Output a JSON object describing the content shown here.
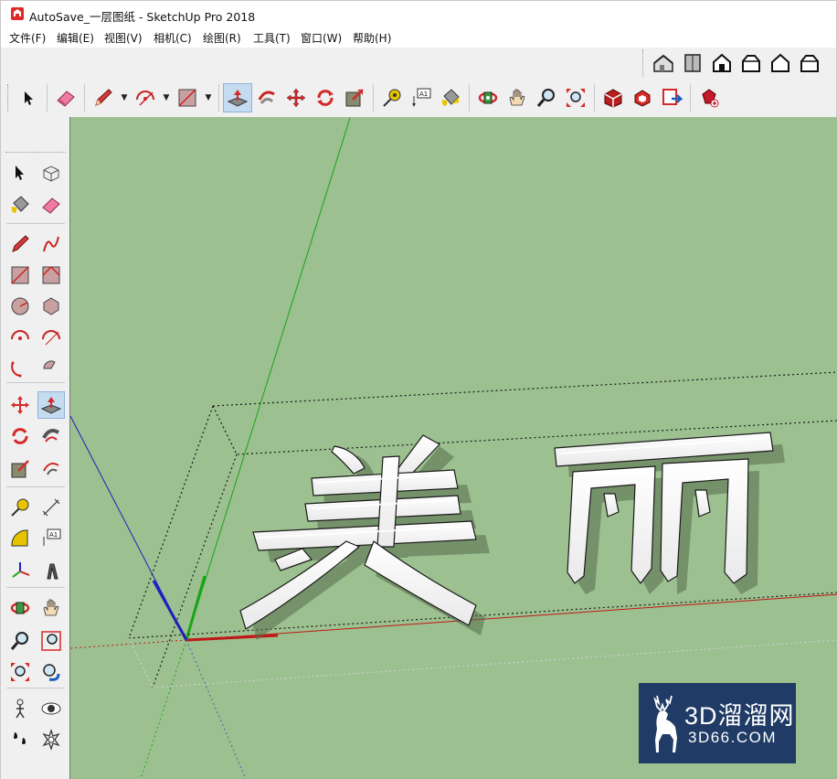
{
  "window": {
    "title": "AutoSave_一层图纸 - SketchUp Pro 2018",
    "app_icon": "sketchup-logo-icon"
  },
  "menu": {
    "items": [
      {
        "label": "文件(F)"
      },
      {
        "label": "编辑(E)"
      },
      {
        "label": "视图(V)"
      },
      {
        "label": "相机(C)"
      },
      {
        "label": "绘图(R)"
      },
      {
        "label": "工具(T)"
      },
      {
        "label": "窗口(W)"
      },
      {
        "label": "帮助(H)"
      }
    ]
  },
  "toolbar": {
    "views": [
      "iso-view-icon",
      "top-view-icon",
      "front-view-icon",
      "right-view-icon",
      "back-view-icon",
      "left-view-icon"
    ],
    "main": [
      "select-icon",
      "eraser-icon",
      "pencil-icon",
      "arc-icon",
      "rectangle-icon",
      "push-pull-icon",
      "follow-me-icon",
      "move-icon",
      "rotate-icon",
      "scale-icon",
      "tape-measure-icon",
      "text-icon",
      "paint-bucket-icon",
      "orbit-icon",
      "pan-icon",
      "zoom-icon",
      "zoom-extents-icon",
      "warehouse-icon",
      "components-icon",
      "share-model-icon",
      "extension-warehouse-icon"
    ],
    "text_label": "A1",
    "active": "push-pull-icon"
  },
  "left_toolbar": {
    "tools": [
      "select-icon",
      "make-component-icon",
      "paint-bucket-icon",
      "eraser-icon",
      "line-icon",
      "freehand-icon",
      "rectangle-icon",
      "rotated-rectangle-icon",
      "circle-icon",
      "polygon-icon",
      "arc-icon",
      "two-point-arc-icon",
      "three-point-arc-icon",
      "pie-icon",
      "move-icon",
      "push-pull-icon",
      "rotate-icon",
      "follow-me-icon",
      "scale-icon",
      "offset-icon",
      "tape-measure-icon",
      "dimension-icon",
      "protractor-icon",
      "text-icon",
      "axes-icon",
      "3d-text-icon",
      "orbit-icon",
      "pan-icon",
      "zoom-icon",
      "zoom-window-icon",
      "zoom-extents-icon",
      "previous-view-icon",
      "position-camera-icon",
      "look-around-icon",
      "walk-icon",
      "section-plane-icon"
    ],
    "text_label": "A1",
    "active": "push-pull-icon"
  },
  "viewport": {
    "background": "#9cc08f",
    "model_text": "美丽",
    "axis_colors": {
      "red": "#cc0000",
      "green": "#00aa00",
      "blue": "#0000cc"
    }
  },
  "watermark": {
    "main": "3D溜溜网",
    "sub": "3D66.COM",
    "background": "#1f3b66"
  }
}
